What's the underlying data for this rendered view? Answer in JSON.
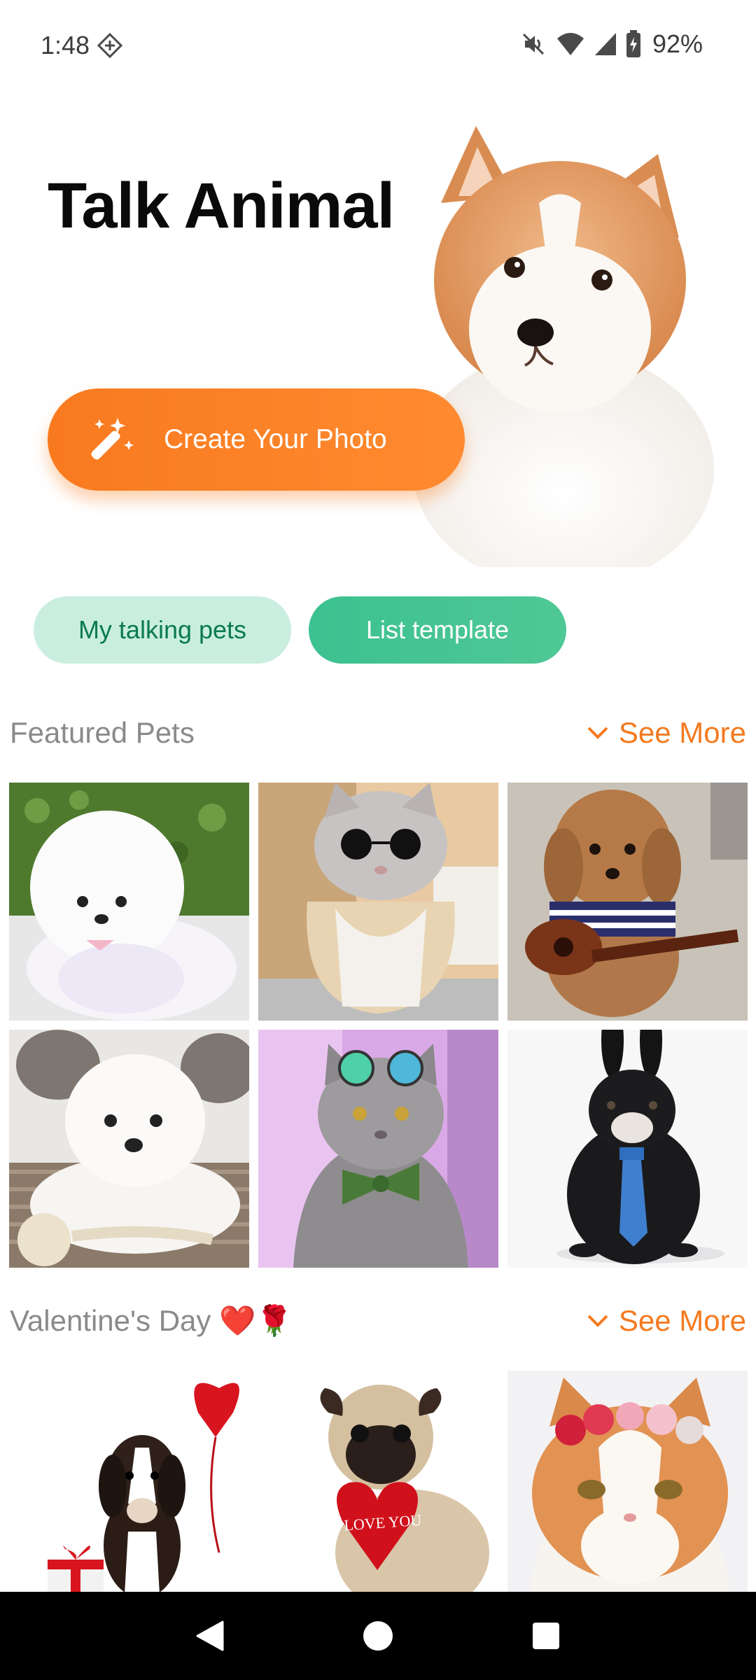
{
  "status_bar": {
    "time": "1:48",
    "battery": "92%"
  },
  "hero": {
    "title": "Talk Animal",
    "create_button_label": "Create Your Photo"
  },
  "pills": {
    "my_talking_pets": "My talking pets",
    "list_template": "List template"
  },
  "featured": {
    "title": "Featured Pets",
    "see_more": "See More",
    "items": [
      "white-pomeranian",
      "cat-with-sunglasses",
      "poodle-with-guitar",
      "fluffy-white-dog",
      "grey-cat-with-bowtie",
      "black-bunny-with-tie"
    ]
  },
  "valentine": {
    "title": "Valentine's Day",
    "emoji": "❤️🌹",
    "see_more": "See More",
    "items": [
      "beagle-puppy-with-balloon",
      "pug-with-heart",
      "cat-with-flower-crown"
    ],
    "pug_heart_text": "I LOVE YOU"
  },
  "colors": {
    "accent_orange": "#f97a1e",
    "green": "#3cc190",
    "green_light": "#c9eedf"
  }
}
